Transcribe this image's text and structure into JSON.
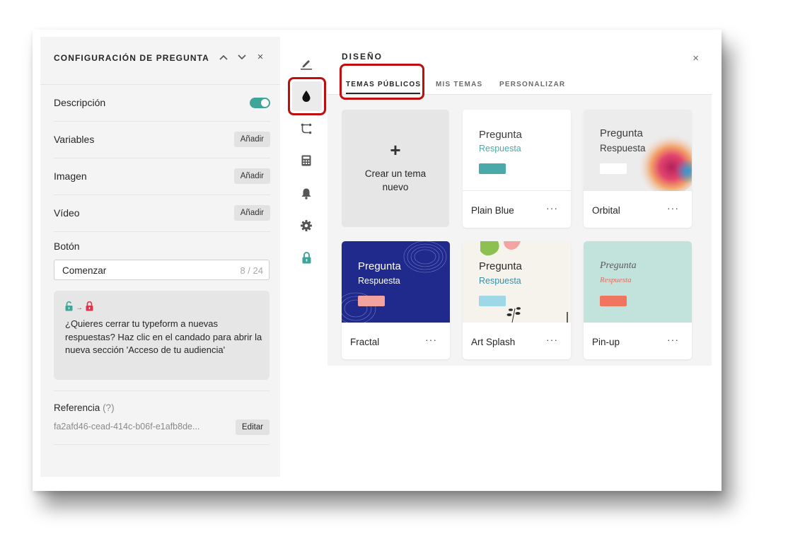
{
  "left_panel": {
    "title": "CONFIGURACIÓN DE PREGUNTA",
    "controls": {
      "up": "⌃",
      "down": "⌄",
      "close": "×"
    },
    "rows": [
      {
        "label": "Descripción",
        "toggle_on": true
      },
      {
        "label": "Variables",
        "action": "Añadir"
      },
      {
        "label": "Imagen",
        "action": "Añadir"
      },
      {
        "label": "Vídeo",
        "action": "Añadir"
      }
    ],
    "button_field": {
      "label": "Botón",
      "value": "Comenzar",
      "counter": "8 / 24"
    },
    "info_box": {
      "text": "¿Quieres cerrar tu typeform a nuevas respuestas? Haz clic en el candado para abrir la nueva sección 'Acceso de tu audiencia'",
      "unlocked_color": "#3fa59a",
      "locked_color": "#e0334c"
    },
    "reference": {
      "label": "Referencia",
      "hint": "(?)",
      "value": "fa2afd46-cead-414c-b06f-e1afb8de...",
      "action": "Editar"
    }
  },
  "rail": {
    "icons": [
      "pen-icon",
      "drop-icon",
      "branch-icon",
      "calculator-icon",
      "bell-icon",
      "gear-icon",
      "lock-icon"
    ],
    "active": "drop-icon",
    "lock_color": "#3fa59a"
  },
  "design_panel": {
    "title": "DISEÑO",
    "close": "×",
    "tabs": [
      {
        "label": "TEMAS PÚBLICOS",
        "active": true
      },
      {
        "label": "MIS TEMAS",
        "active": false
      },
      {
        "label": "PERSONALIZAR",
        "active": false
      }
    ],
    "new_theme": {
      "icon": "+",
      "label_line1": "Crear un tema",
      "label_line2": "nuevo"
    },
    "themes": [
      {
        "name": "Plain Blue",
        "question": "Pregunta",
        "answer": "Respuesta",
        "bg": "#ffffff",
        "q_color": "#3d3d3d",
        "a_color": "#4aa9a9",
        "btn_color": "#4aa9a9"
      },
      {
        "name": "Orbital",
        "question": "Pregunta",
        "answer": "Respuesta",
        "bg": "#ececed",
        "q_color": "#3d3d3d",
        "a_color": "#3d3d3d",
        "btn_color": "#ffffff"
      },
      {
        "name": "Fractal",
        "question": "Pregunta",
        "answer": "Respuesta",
        "bg": "#1f2a8c",
        "q_color": "#ffffff",
        "a_color": "#ffffff",
        "btn_color": "#f2a3a0"
      },
      {
        "name": "Art Splash",
        "question": "Pregunta",
        "answer": "Respuesta",
        "bg": "#f6f3ec",
        "q_color": "#2d2d2d",
        "a_color": "#3a8ea8",
        "btn_color": "#9ed8e6"
      },
      {
        "name": "Pin-up",
        "question": "Pregunta",
        "answer": "Respuesta",
        "bg": "#c2e2dc",
        "q_color": "#5a5a5a",
        "a_color": "#e46d5c",
        "btn_color": "#f07561"
      }
    ],
    "more": "···",
    "highlight_color": "#c00d0d"
  }
}
